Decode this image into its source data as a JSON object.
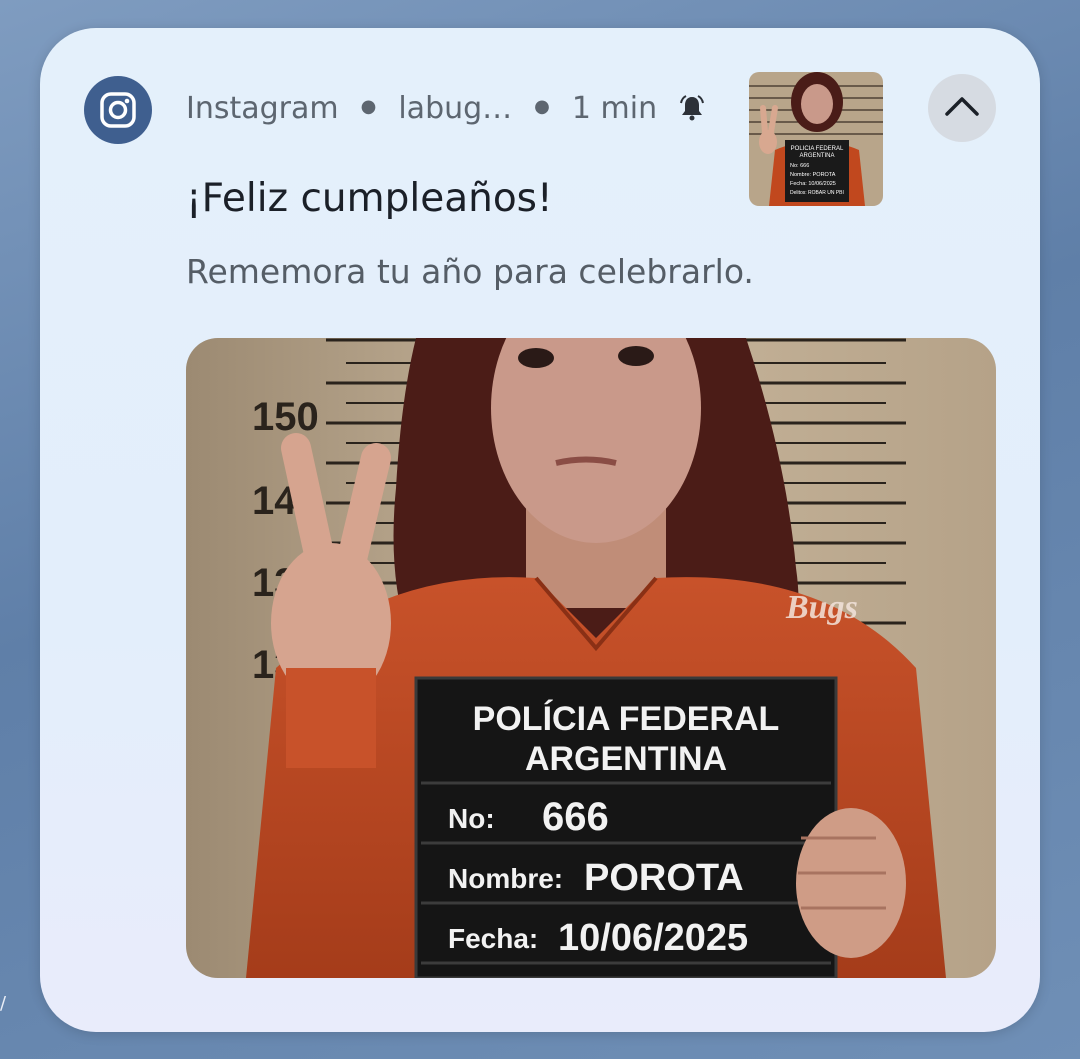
{
  "notification": {
    "app_name": "Instagram",
    "account": "labug…",
    "time": "1 min",
    "title": "¡Feliz cumpleaños!",
    "body": "Rememora tu año para celebrarlo.",
    "app_icon": "instagram-icon",
    "alert_icon": "bell-ringing-icon",
    "collapse_icon": "chevron-up-icon",
    "accent_color": "#3f5f8f"
  },
  "image": {
    "ruler_marks": [
      "150",
      "14",
      "13",
      "13"
    ],
    "sign_lines": [
      "POLÍCIA FEDERAL",
      "ARGENTINA"
    ],
    "sign_no_label": "No:",
    "sign_no_value": "666",
    "sign_name_label": "Nombre:",
    "sign_name_value": "POROTA",
    "sign_date_label": "Fecha:",
    "sign_date_value": "10/06/2025",
    "shirt_text": "Bugs"
  },
  "thumbnail": {
    "sign_lines": [
      "POLICIA FEDERAL",
      "ARGENTINA"
    ],
    "rows": [
      "No: 666",
      "Nombre: POROTA",
      "Fecha: 10/06/2025",
      "Delitos: ROBAR UN PBI"
    ]
  }
}
